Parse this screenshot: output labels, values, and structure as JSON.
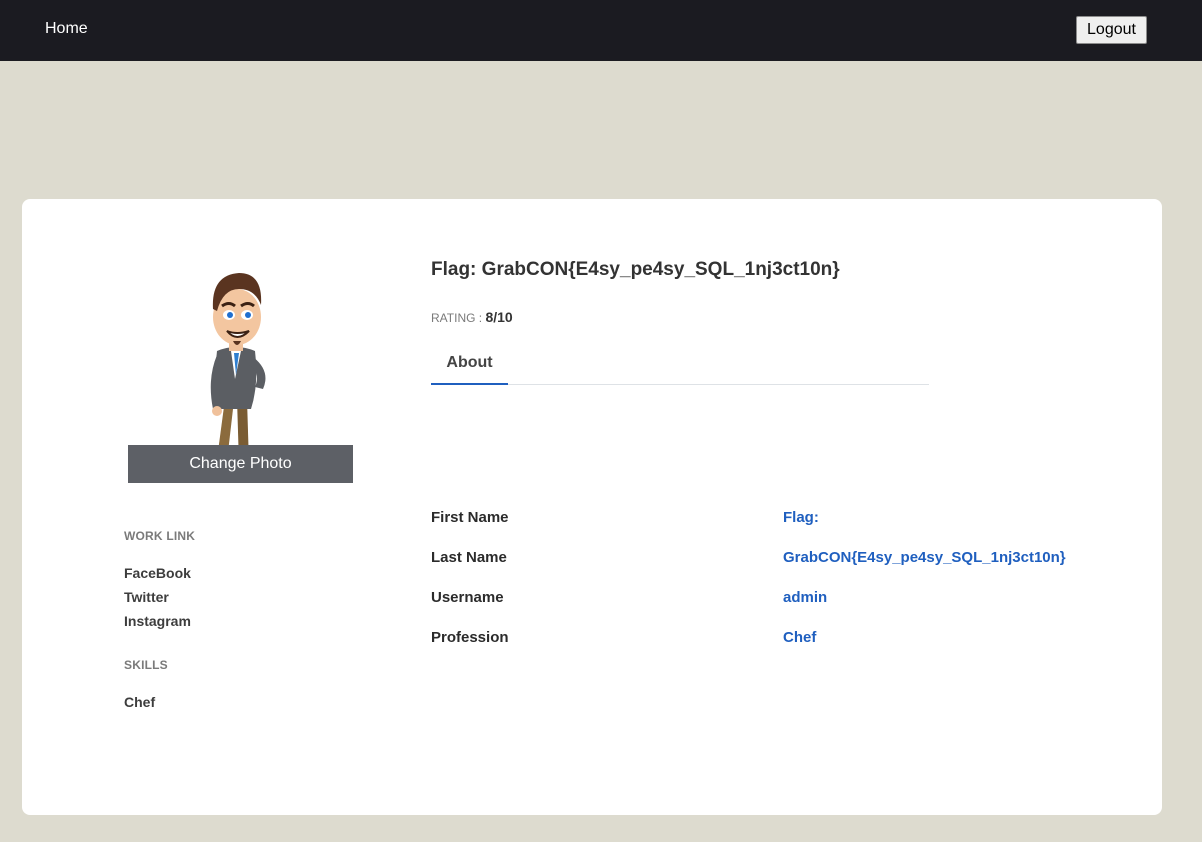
{
  "nav": {
    "home_label": "Home",
    "logout_label": "Logout"
  },
  "profile": {
    "title": "Flag: GrabCON{E4sy_pe4sy_SQL_1nj3ct10n}",
    "rating_label": "RATING : ",
    "rating_value": "8/10",
    "change_photo_label": "Change Photo",
    "tabs": [
      {
        "label": "About",
        "active": true
      }
    ]
  },
  "sidebar": {
    "work_link_heading": "WORK LINK",
    "work_links": [
      "FaceBook",
      "Twitter",
      "Instagram"
    ],
    "skills_heading": "SKILLS",
    "skills": [
      "Chef"
    ]
  },
  "about": {
    "rows": [
      {
        "label": "First Name",
        "value": "Flag:"
      },
      {
        "label": "Last Name",
        "value": "GrabCON{E4sy_pe4sy_SQL_1nj3ct10n}"
      },
      {
        "label": "Username",
        "value": "admin"
      },
      {
        "label": "Profession",
        "value": "Chef"
      }
    ]
  },
  "colors": {
    "navbar": "#1b1b21",
    "page_bg": "#dddbcf",
    "accent": "#1f5fbf",
    "photo_button": "#5d6066"
  }
}
